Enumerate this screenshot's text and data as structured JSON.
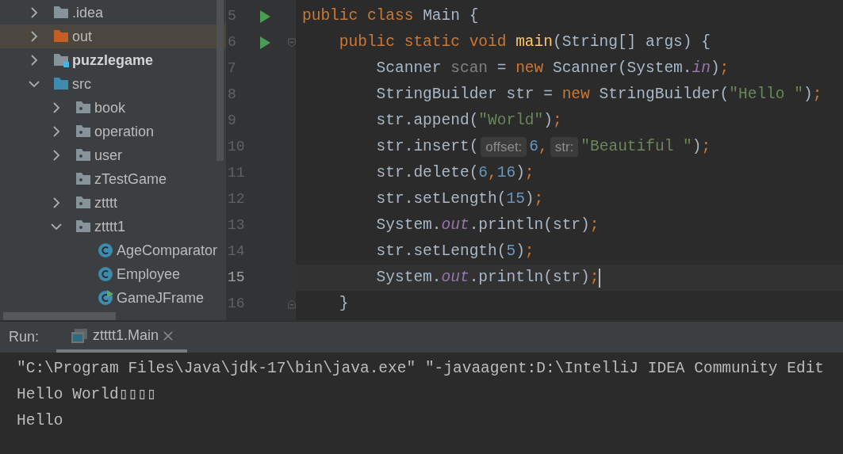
{
  "project_tree": [
    {
      "label": ".idea",
      "kind": "folder",
      "expanded": false,
      "selected": false
    },
    {
      "label": "out",
      "kind": "excluded",
      "expanded": false,
      "selected": true
    },
    {
      "label": "puzzlegame",
      "kind": "module",
      "expanded": false,
      "selected": false
    },
    {
      "label": "src",
      "kind": "source",
      "expanded": true,
      "selected": false,
      "children": [
        {
          "label": "book",
          "kind": "package",
          "expanded": false,
          "selected": false
        },
        {
          "label": "operation",
          "kind": "package",
          "expanded": false,
          "selected": false
        },
        {
          "label": "user",
          "kind": "package",
          "expanded": false,
          "selected": false
        },
        {
          "label": "zTestGame",
          "kind": "package",
          "selected": false
        },
        {
          "label": "ztttt",
          "kind": "package",
          "expanded": false,
          "selected": false
        },
        {
          "label": "ztttt1",
          "kind": "package",
          "expanded": true,
          "selected": false,
          "children": [
            {
              "label": "AgeComparator",
              "kind": "class",
              "selected": false
            },
            {
              "label": "Employee",
              "kind": "class",
              "selected": false
            },
            {
              "label": "GameJFrame",
              "kind": "runnable_class",
              "selected": false
            }
          ]
        }
      ]
    }
  ],
  "editor": {
    "lines": [
      {
        "number": "5",
        "run_icon": true,
        "fold_start": false,
        "fold_end": false,
        "current": false,
        "tokens": [
          {
            "kind": "kw",
            "text": "public class "
          },
          {
            "kind": "plain",
            "text": "Main {"
          }
        ]
      },
      {
        "number": "6",
        "run_icon": true,
        "fold_start": true,
        "fold_end": false,
        "current": false,
        "tokens": [
          {
            "kind": "kw",
            "text": "    public static void "
          },
          {
            "kind": "method",
            "text": "main"
          },
          {
            "kind": "plain",
            "text": "(String[] args) {"
          }
        ]
      },
      {
        "number": "7",
        "run_icon": false,
        "fold_start": false,
        "fold_end": false,
        "current": false,
        "tokens": [
          {
            "kind": "plain",
            "text": "        Scanner "
          },
          {
            "kind": "unused",
            "text": "scan"
          },
          {
            "kind": "plain",
            "text": " = "
          },
          {
            "kind": "kw",
            "text": "new "
          },
          {
            "kind": "plain",
            "text": "Scanner(System."
          },
          {
            "kind": "field",
            "text": "in"
          },
          {
            "kind": "plain",
            "text": ")"
          },
          {
            "kind": "kw",
            "text": ";"
          }
        ]
      },
      {
        "number": "8",
        "run_icon": false,
        "fold_start": false,
        "fold_end": false,
        "current": false,
        "tokens": [
          {
            "kind": "plain",
            "text": "        StringBuilder str = "
          },
          {
            "kind": "kw",
            "text": "new "
          },
          {
            "kind": "plain",
            "text": "StringBuilder("
          },
          {
            "kind": "str",
            "text": "\"Hello \""
          },
          {
            "kind": "plain",
            "text": ")"
          },
          {
            "kind": "kw",
            "text": ";"
          }
        ]
      },
      {
        "number": "9",
        "run_icon": false,
        "fold_start": false,
        "fold_end": false,
        "current": false,
        "tokens": [
          {
            "kind": "plain",
            "text": "        str.append("
          },
          {
            "kind": "str",
            "text": "\"World\""
          },
          {
            "kind": "plain",
            "text": ")"
          },
          {
            "kind": "kw",
            "text": ";"
          }
        ]
      },
      {
        "number": "10",
        "run_icon": false,
        "fold_start": false,
        "fold_end": false,
        "current": false,
        "tokens": [
          {
            "kind": "plain",
            "text": "        str.insert("
          },
          {
            "kind": "hint",
            "text": "offset:"
          },
          {
            "kind": "num",
            "text": "6"
          },
          {
            "kind": "kw",
            "text": ","
          },
          {
            "kind": "hint",
            "text": "str:"
          },
          {
            "kind": "str",
            "text": "\"Beautiful \""
          },
          {
            "kind": "plain",
            "text": ")"
          },
          {
            "kind": "kw",
            "text": ";"
          }
        ]
      },
      {
        "number": "11",
        "run_icon": false,
        "fold_start": false,
        "fold_end": false,
        "current": false,
        "tokens": [
          {
            "kind": "plain",
            "text": "        str.delete("
          },
          {
            "kind": "num",
            "text": "6"
          },
          {
            "kind": "kw",
            "text": ","
          },
          {
            "kind": "num",
            "text": "16"
          },
          {
            "kind": "plain",
            "text": ")"
          },
          {
            "kind": "kw",
            "text": ";"
          }
        ]
      },
      {
        "number": "12",
        "run_icon": false,
        "fold_start": false,
        "fold_end": false,
        "current": false,
        "tokens": [
          {
            "kind": "plain",
            "text": "        str.setLength("
          },
          {
            "kind": "num",
            "text": "15"
          },
          {
            "kind": "plain",
            "text": ")"
          },
          {
            "kind": "kw",
            "text": ";"
          }
        ]
      },
      {
        "number": "13",
        "run_icon": false,
        "fold_start": false,
        "fold_end": false,
        "current": false,
        "tokens": [
          {
            "kind": "plain",
            "text": "        System."
          },
          {
            "kind": "field",
            "text": "out"
          },
          {
            "kind": "plain",
            "text": ".println(str)"
          },
          {
            "kind": "kw",
            "text": ";"
          }
        ]
      },
      {
        "number": "14",
        "run_icon": false,
        "fold_start": false,
        "fold_end": false,
        "current": false,
        "tokens": [
          {
            "kind": "plain",
            "text": "        str.setLength("
          },
          {
            "kind": "num",
            "text": "5"
          },
          {
            "kind": "plain",
            "text": ")"
          },
          {
            "kind": "kw",
            "text": ";"
          }
        ]
      },
      {
        "number": "15",
        "run_icon": false,
        "fold_start": false,
        "fold_end": false,
        "current": true,
        "tokens": [
          {
            "kind": "plain",
            "text": "        System."
          },
          {
            "kind": "field",
            "text": "out"
          },
          {
            "kind": "plain",
            "text": ".println(str)"
          },
          {
            "kind": "kw",
            "text": ";"
          }
        ]
      },
      {
        "number": "16",
        "run_icon": false,
        "fold_start": false,
        "fold_end": true,
        "current": false,
        "tokens": [
          {
            "kind": "plain",
            "text": "    }"
          }
        ]
      }
    ]
  },
  "run_panel": {
    "label": "Run:",
    "tabs": [
      {
        "label": "ztttt1.Main",
        "selected": true
      }
    ],
    "output": [
      "\"C:\\Program Files\\Java\\jdk-17\\bin\\java.exe\" \"-javaagent:D:\\IntelliJ IDEA Community Edit",
      "Hello World▯▯▯▯",
      "Hello"
    ]
  }
}
